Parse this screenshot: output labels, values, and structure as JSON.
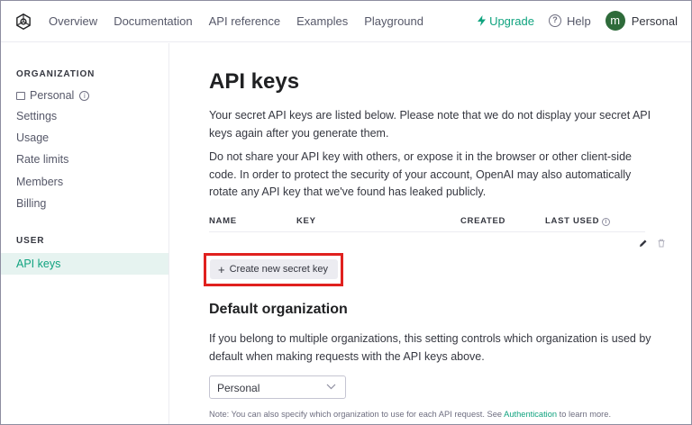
{
  "nav": {
    "items": [
      "Overview",
      "Documentation",
      "API reference",
      "Examples",
      "Playground"
    ],
    "upgrade": "Upgrade",
    "help": "Help",
    "avatar_initial": "m",
    "account": "Personal"
  },
  "sidebar": {
    "org_heading": "ORGANIZATION",
    "org_name": "Personal",
    "org_items": [
      "Settings",
      "Usage",
      "Rate limits",
      "Members",
      "Billing"
    ],
    "user_heading": "USER",
    "active_item": "API keys"
  },
  "main": {
    "title": "API keys",
    "intro": "Your secret API keys are listed below. Please note that we do not display your secret API keys again after you generate them.",
    "warning": "Do not share your API key with others, or expose it in the browser or other client-side code. In order to protect the security of your account, OpenAI may also automatically rotate any API key that we've found has leaked publicly.",
    "table_headers": {
      "name": "NAME",
      "key": "KEY",
      "created": "CREATED",
      "last_used": "LAST USED"
    },
    "create_button": "Create new secret key",
    "default_org_title": "Default organization",
    "default_org_text": "If you belong to multiple organizations, this setting controls which organization is used by default when making requests with the API keys above.",
    "org_select_value": "Personal",
    "note_prefix": "Note: You can also specify which organization to use for each API request. See ",
    "note_link": "Authentication",
    "note_suffix": " to learn more."
  },
  "colors": {
    "accent": "#10a37f",
    "highlight": "#e0211f",
    "active_bg": "#e6f3f0"
  }
}
